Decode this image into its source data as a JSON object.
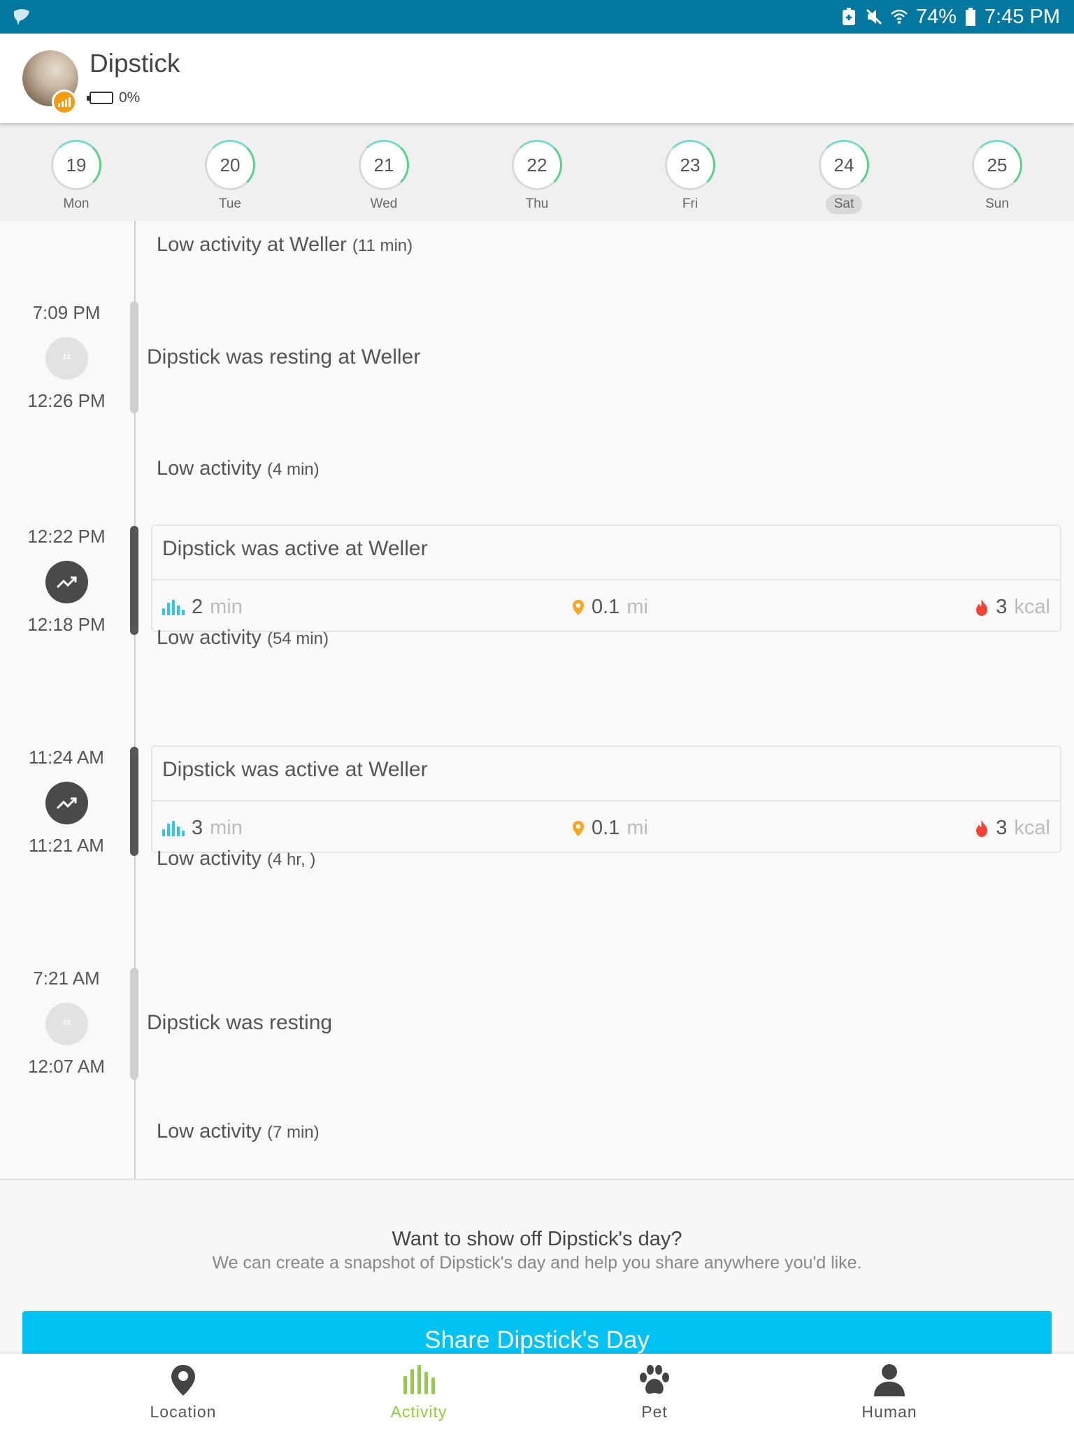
{
  "status_bar": {
    "battery_percent": "74%",
    "time": "7:45 PM"
  },
  "header": {
    "pet_name": "Dipstick",
    "device_battery": "0%"
  },
  "days": [
    {
      "num": "19",
      "label": "Mon"
    },
    {
      "num": "20",
      "label": "Tue"
    },
    {
      "num": "21",
      "label": "Wed"
    },
    {
      "num": "22",
      "label": "Thu"
    },
    {
      "num": "23",
      "label": "Fri"
    },
    {
      "num": "24",
      "label": "Sat",
      "selected": true
    },
    {
      "num": "25",
      "label": "Sun"
    }
  ],
  "timeline": {
    "low1": {
      "label": "Low activity at Weller",
      "duration": "(11 min)"
    },
    "rest1": {
      "start": "7:09 PM",
      "end": "12:26 PM",
      "text": "Dipstick was resting at Weller"
    },
    "low2": {
      "label": "Low activity",
      "duration": "(4 min)"
    },
    "active1": {
      "start": "12:22 PM",
      "end": "12:18 PM",
      "title": "Dipstick was active at Weller",
      "minutes": "2",
      "minutes_unit": "min",
      "distance": "0.1",
      "distance_unit": "mi",
      "kcal": "3",
      "kcal_unit": "kcal"
    },
    "low3": {
      "label": "Low activity",
      "duration": "(54 min)"
    },
    "active2": {
      "start": "11:24 AM",
      "end": "11:21 AM",
      "title": "Dipstick was active at Weller",
      "minutes": "3",
      "minutes_unit": "min",
      "distance": "0.1",
      "distance_unit": "mi",
      "kcal": "3",
      "kcal_unit": "kcal"
    },
    "low4": {
      "label": "Low activity",
      "duration": "(4 hr, )"
    },
    "rest2": {
      "start": "7:21 AM",
      "end": "12:07 AM",
      "text": "Dipstick was resting"
    },
    "low5": {
      "label": "Low activity",
      "duration": "(7 min)"
    }
  },
  "share": {
    "question": "Want to show off Dipstick's day?",
    "subtitle": "We can create a snapshot of Dipstick's day and help you share anywhere you'd like.",
    "button": "Share Dipstick's Day"
  },
  "nav": {
    "location": "Location",
    "activity": "Activity",
    "pet": "Pet",
    "human": "Human"
  },
  "colors": {
    "status_bar": "#0278a0",
    "accent_green": "#8fd03a",
    "share_button": "#00c2f2",
    "stat_bars": "#36c5ea",
    "location_pin": "#f5a623",
    "flame": "#f44336",
    "badge_orange": "#f39c12"
  }
}
